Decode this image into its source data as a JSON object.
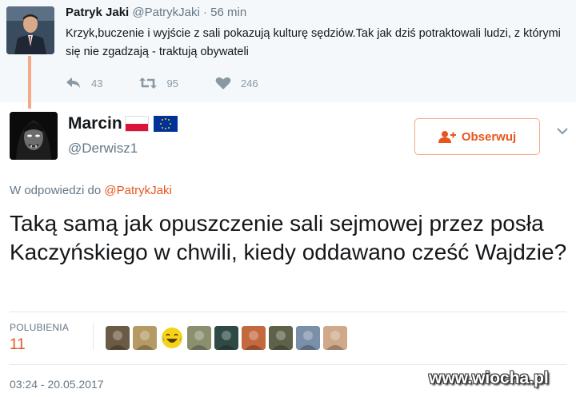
{
  "parent_tweet": {
    "author_name": "Patryk Jaki",
    "author_handle": "@PatrykJaki",
    "separator": "·",
    "time": "56 min",
    "text": "Krzyk,buczenie i wyjście z sali pokazują kulturę sędziów.Tak jak dziś potraktowali ludzi, z którymi się nie zgadzają - traktują obywateli",
    "actions": {
      "reply_count": "43",
      "retweet_count": "95",
      "like_count": "246"
    }
  },
  "main_tweet": {
    "author_name": "Marcin",
    "author_handle": "@Derwisz1",
    "follow_label": "Obserwuj",
    "reply_prefix": "W odpowiedzi do",
    "reply_mention": "@PatrykJaki",
    "text": "Taką samą jak opuszczenie sali sejmowej przez posła Kaczyńskiego w chwili, kiedy oddawano cześć Wajdzie?",
    "likes_label": "POLUBIENIA",
    "likes_count": "11",
    "timestamp": "03:24 - 20.05.2017"
  },
  "likers": [
    {
      "icon": "liker-avatar",
      "color": "#6b5a44"
    },
    {
      "icon": "liker-avatar",
      "color": "#b59a66"
    },
    {
      "icon": "laughing-emoji-avatar",
      "color": "#f7d21a"
    },
    {
      "icon": "liker-avatar",
      "color": "#8a8f6e"
    },
    {
      "icon": "liker-avatar",
      "color": "#2f4a44"
    },
    {
      "icon": "liker-avatar",
      "color": "#c4683f"
    },
    {
      "icon": "liker-avatar",
      "color": "#5d6248"
    },
    {
      "icon": "liker-avatar",
      "color": "#7a8fa8"
    },
    {
      "icon": "liker-avatar",
      "color": "#cfa98a"
    }
  ],
  "watermark": "www.wiocha.pl",
  "colors": {
    "accent": "#e8561f",
    "muted": "#657786",
    "parent_background": "#f5f8fa",
    "thread_line": "#f4a98a"
  }
}
